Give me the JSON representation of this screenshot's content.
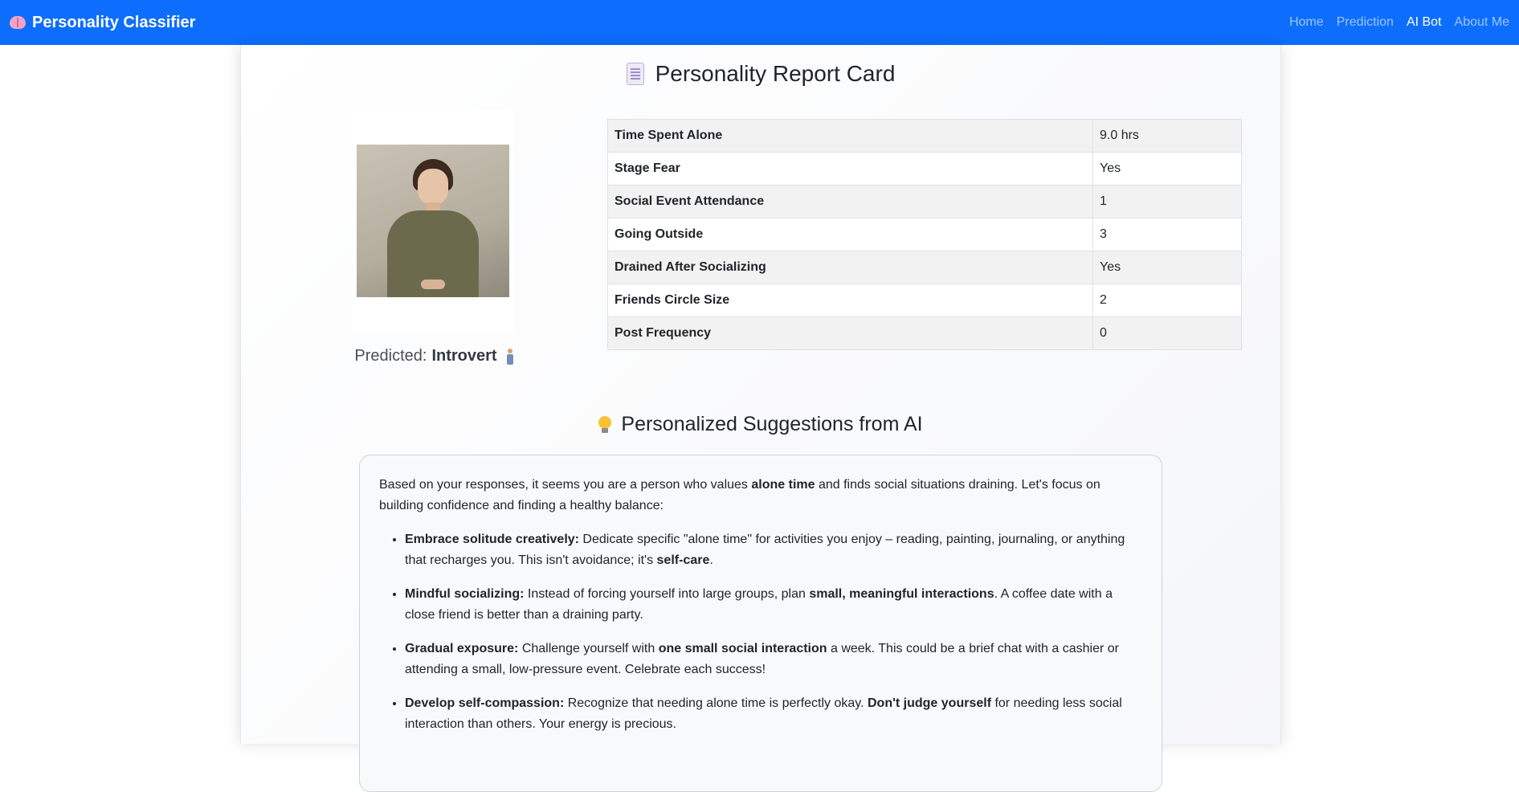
{
  "navbar": {
    "brand": "Personality Classifier",
    "brand_icon": "brain-icon",
    "links": [
      {
        "label": "Home",
        "active": false
      },
      {
        "label": "Prediction",
        "active": false
      },
      {
        "label": "AI Bot",
        "active": true
      },
      {
        "label": "About Me",
        "active": false
      }
    ]
  },
  "report": {
    "title": "Personality Report Card",
    "title_icon": "scroll-icon",
    "predicted_label": "Predicted:",
    "predicted_value": "Introvert",
    "predicted_icon": "standing-person-icon",
    "rows": [
      {
        "label": "Time Spent Alone",
        "value": "9.0 hrs"
      },
      {
        "label": "Stage Fear",
        "value": "Yes"
      },
      {
        "label": "Social Event Attendance",
        "value": "1"
      },
      {
        "label": "Going Outside",
        "value": "3"
      },
      {
        "label": "Drained After Socializing",
        "value": "Yes"
      },
      {
        "label": "Friends Circle Size",
        "value": "2"
      },
      {
        "label": "Post Frequency",
        "value": "0"
      }
    ]
  },
  "suggestions": {
    "title": "Personalized Suggestions from AI",
    "title_icon": "lightbulb-icon",
    "intro": {
      "part1": "Based on your responses, it seems you are a person who values ",
      "bold1": "alone time",
      "part2": " and finds social situations draining. Let's focus on building confidence and finding a healthy balance:"
    },
    "items": [
      {
        "heading": "Embrace solitude creatively:",
        "text1": " Dedicate specific \"alone time\" for activities you enjoy – reading, painting, journaling, or anything that recharges you. This isn't avoidance; it's ",
        "bold": "self-care",
        "text2": "."
      },
      {
        "heading": "Mindful socializing:",
        "text1": " Instead of forcing yourself into large groups, plan ",
        "bold": "small, meaningful interactions",
        "text2": ". A coffee date with a close friend is better than a draining party."
      },
      {
        "heading": "Gradual exposure:",
        "text1": " Challenge yourself with ",
        "bold": "one small social interaction",
        "text2": " a week. This could be a brief chat with a cashier or attending a small, low-pressure event. Celebrate each success!"
      },
      {
        "heading": "Develop self-compassion:",
        "text1": " Recognize that needing alone time is perfectly okay. ",
        "bold": "Don't judge yourself",
        "text2": " for needing less social interaction than others. Your energy is precious."
      }
    ]
  },
  "colors": {
    "navbar": "#0d6efd",
    "table_stripe": "#f2f2f2"
  }
}
